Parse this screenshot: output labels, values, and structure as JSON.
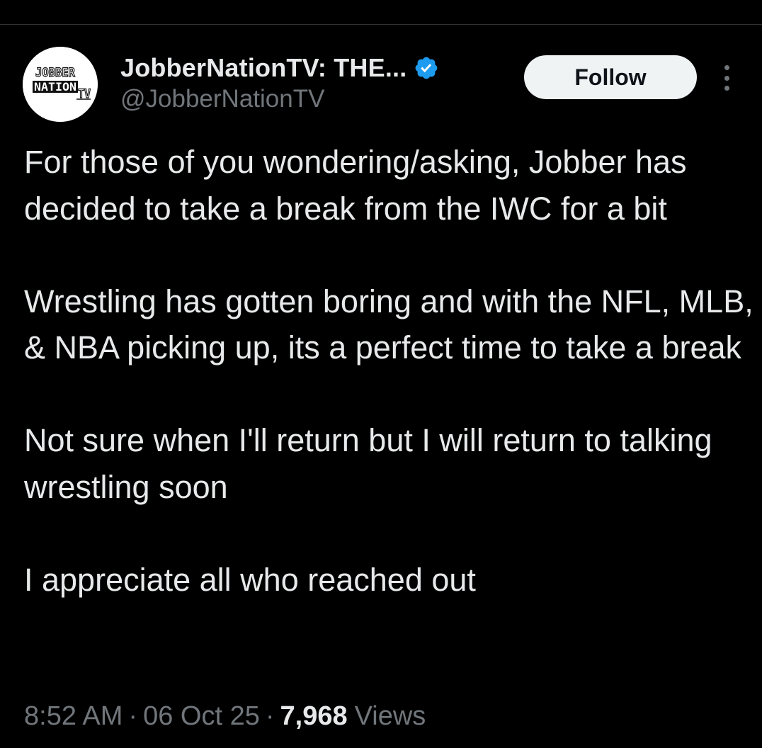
{
  "author": {
    "display_name": "JobberNationTV: THE...",
    "handle": "@JobberNationTV",
    "verified": true,
    "avatar_logo_text": [
      "JOBBER",
      "NATION",
      "TV"
    ]
  },
  "actions": {
    "follow_label": "Follow",
    "more_icon": "more-vertical-icon"
  },
  "tweet": {
    "paragraphs": [
      "For those of you wondering/asking, Jobber has decided to take a break from the IWC for a bit",
      "Wrestling has gotten boring and with the NFL, MLB, & NBA picking up, its a perfect time to take a break",
      "Not sure when I'll return but I will return to talking wrestling soon",
      "I appreciate all who reached out"
    ]
  },
  "meta": {
    "time": "8:52 AM",
    "separator": "·",
    "date": "06 Oct 25",
    "views_count": "7,968",
    "views_label": "Views"
  },
  "colors": {
    "background": "#000000",
    "text_primary": "#e7e9ea",
    "text_secondary": "#71767b",
    "verified_blue": "#1d9bf0",
    "follow_bg": "#eff3f4"
  }
}
